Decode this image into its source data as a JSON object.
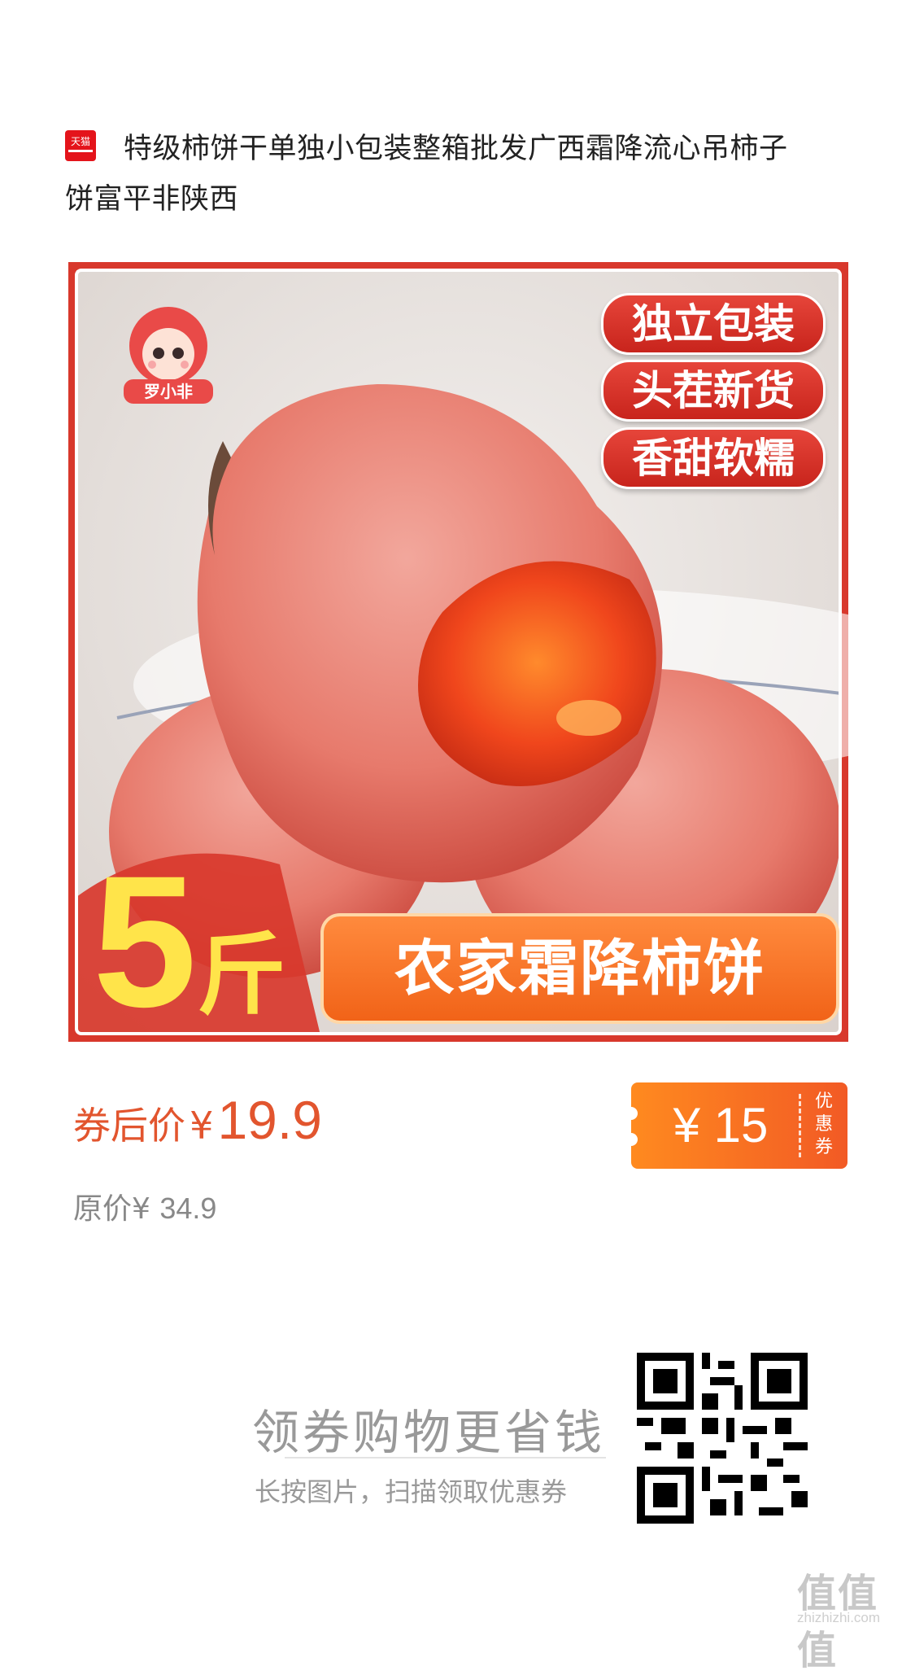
{
  "header": {
    "platform_badge": "天猫",
    "title": "特级柿饼干单独小包装整箱批发广西霜降流心吊柿子饼富平非陕西"
  },
  "product_image": {
    "badges": [
      "独立包装",
      "头茬新货",
      "香甜软糯"
    ],
    "brand_logo_text": "罗小非",
    "weight_number": "5",
    "weight_unit": "斤",
    "slogan": "农家霜降柿饼"
  },
  "price": {
    "after_coupon_label": "券后价",
    "currency": "¥",
    "after_coupon_value": "19.9",
    "original_label": "原价",
    "original_value": "34.9"
  },
  "coupon": {
    "amount": "¥ 15",
    "label_chars": [
      "优",
      "惠",
      "券"
    ]
  },
  "promo": {
    "headline": "领券购物更省钱",
    "subline": "长按图片，扫描领取优惠券"
  },
  "watermark": {
    "logo": "值值值",
    "url": "zhizhizhi.com"
  },
  "colors": {
    "price": "#e2552e",
    "coupon_start": "#ff8a1f",
    "coupon_end": "#f25a25",
    "tmall_red": "#e4141b"
  }
}
